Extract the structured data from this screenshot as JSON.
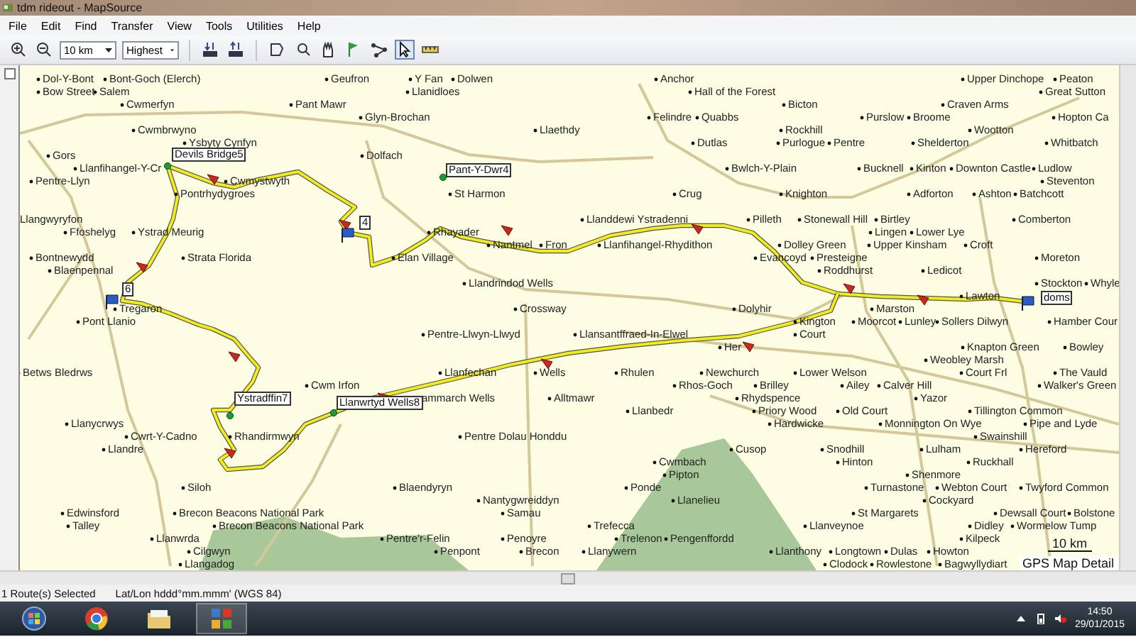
{
  "window": {
    "title": "tdm rideout - MapSource"
  },
  "menu": [
    "File",
    "Edit",
    "Find",
    "Transfer",
    "View",
    "Tools",
    "Utilities",
    "Help"
  ],
  "toolbar": {
    "zoom_scale": "10 km",
    "detail_level": "Highest"
  },
  "map": {
    "places": [
      "Dol-Y-Bont",
      "Bont-Goch (Elerch)",
      "Geufron",
      "Y Fan",
      "Dolwen",
      "Anchor",
      "Upper Dinchope",
      "Peaton",
      "Bow Street",
      "Salem",
      "Llanidloes",
      "Hall of the Forest",
      "Great Sutton",
      "Cwmerfyn",
      "Pant Mawr",
      "Bicton",
      "Craven Arms",
      "Glyn-Brochan",
      "Felindre",
      "Quabbs",
      "Purslow",
      "Broome",
      "Hopton Ca",
      "Cwmbrwyno",
      "Llaethdy",
      "Rockhill",
      "Wootton",
      "Ysbyty Cynfyn",
      "Dutlas",
      "Purlogue",
      "Pentre",
      "Shelderton",
      "Whitbatch",
      "Gors",
      "Dolfach",
      "Llanfihangel-Y-Cr",
      "Bwlch-Y-Plain",
      "Bucknell",
      "Kinton",
      "Downton Castle",
      "Ludlow",
      "Pentre-Llyn",
      "Cwmystwyth",
      "Steventon",
      "Pontrhydygroes",
      "St Harmon",
      "Crug",
      "Knighton",
      "Adforton",
      "Ashton",
      "Batchcott",
      "Llangwyryfon",
      "Llanddewi Ystradenni",
      "Pilleth",
      "Stonewall Hill",
      "Birtley",
      "Comberton",
      "Ffoshelyg",
      "Ystrad Meurig",
      "Rhayader",
      "Lingen",
      "Lower Lye",
      "Nantmel",
      "Fron",
      "Llanfihangel-Rhydithon",
      "Dolley Green",
      "Upper Kinsham",
      "Croft",
      "Bontnewydd",
      "Strata Florida",
      "Elan Village",
      "Evancoyd",
      "Presteigne",
      "Moreton",
      "Blaenpennal",
      "Roddhurst",
      "Ledicot",
      "Llandrindod Wells",
      "Stockton",
      "Whyle",
      "Lawton",
      "Tregaron",
      "Crossway",
      "Dolyhir",
      "Marston",
      "Pont Llanio",
      "Kington",
      "Moorcot",
      "Lunley",
      "Sollers Dilwyn",
      "Hamber Cour",
      "Pentre-Llwyn-Llwyd",
      "Llansantffraed-In-Elwel",
      "Court",
      "Her",
      "Knapton Green",
      "Bowley",
      "Weobley Marsh",
      "Betws Bledrws",
      "Llanfechan",
      "Wells",
      "Rhulen",
      "Newchurch",
      "Lower Welson",
      "Court Frl",
      "The Vauld",
      "Cwm Irfon",
      "Rhos-Goch",
      "Brilley",
      "Ailey",
      "Calver Hill",
      "Walker's Green",
      "ammarch Wells",
      "Alltmawr",
      "Rhydspence",
      "Yazor",
      "Llanbedr",
      "Priory Wood",
      "Old Court",
      "Tillington Common",
      "Llanycrwys",
      "Hardwicke",
      "Monnington On Wye",
      "Pipe and Lyde",
      "Cwrt-Y-Cadno",
      "Rhandirmwyn",
      "Pentre Dolau Honddu",
      "Swainshill",
      "Llandre",
      "Cusop",
      "Snodhill",
      "Lulham",
      "Hereford",
      "Cwmbach",
      "Hinton",
      "Ruckhall",
      "Pipton",
      "Shenmore",
      "Siloh",
      "Blaendyryn",
      "Ponde",
      "Turnastone",
      "Webton Court",
      "Twyford Common",
      "Nantygwreiddyn",
      "Llanelieu",
      "Cockyard",
      "Edwinsford",
      "Brecon Beacons National Park",
      "Samau",
      "St Margarets",
      "Dewsall Court",
      "Bolstone",
      "Talley",
      "Brecon Beacons National Park",
      "Trefecca",
      "Llanveynoe",
      "Didley",
      "Wormelow Tump",
      "Llanwrda",
      "Pentre'r-Felin",
      "Penoyre",
      "Trelenon",
      "Pengenffordd",
      "Kilpeck",
      "Cilgwyn",
      "Penpont",
      "Brecon",
      "Llanywern",
      "Llanthony",
      "Longtown",
      "Dulas",
      "Howton",
      "Llangadog",
      "Clodock",
      "Rowlestone",
      "Bagwyllydiart"
    ],
    "waypoints": [
      "Devils Bridge5",
      "Pant-Y-Dwr4",
      "4",
      "6",
      "Ystradffin7",
      "Llanwrtyd Wells8",
      "doms"
    ],
    "scale": "10 km",
    "detail_label": "GPS Map Detail"
  },
  "status_bar": [
    "1 Route(s) Selected",
    "Lat/Lon hddd°mm.mmm' (WGS 84)"
  ],
  "taskbar": {
    "time": "14:50",
    "date": "29/01/2015"
  }
}
